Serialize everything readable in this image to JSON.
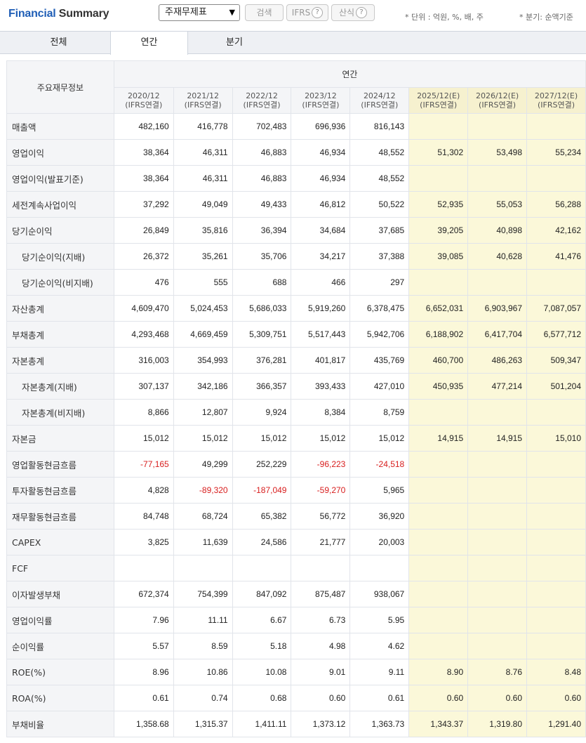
{
  "header": {
    "title_part1": "Financial",
    "title_part2": " Summary",
    "select_value": "주재무제표",
    "search_label": "검색",
    "ifrs_label": "IFRS",
    "formula_label": "산식",
    "help_glyph": "?",
    "unit_note": "* 단위 : 억원, %, 배, 주",
    "period_note": "* 분기: 순액기준"
  },
  "tabs": [
    "전체",
    "연간",
    "분기"
  ],
  "table": {
    "row_header_label": "주요재무정보",
    "group_label": "연간",
    "periods": [
      {
        "year": "2020/12",
        "basis": "(IFRS연결)"
      },
      {
        "year": "2021/12",
        "basis": "(IFRS연결)"
      },
      {
        "year": "2022/12",
        "basis": "(IFRS연결)"
      },
      {
        "year": "2023/12",
        "basis": "(IFRS연결)"
      },
      {
        "year": "2024/12",
        "basis": "(IFRS연결)"
      },
      {
        "year": "2025/12(E)",
        "basis": "(IFRS연결)"
      },
      {
        "year": "2026/12(E)",
        "basis": "(IFRS연결)"
      },
      {
        "year": "2027/12(E)",
        "basis": "(IFRS연결)"
      }
    ],
    "rows": [
      {
        "label": "매출액",
        "indent": false,
        "values": [
          "482,160",
          "416,778",
          "702,483",
          "696,936",
          "816,143",
          "",
          "",
          ""
        ]
      },
      {
        "label": "영업이익",
        "indent": false,
        "values": [
          "38,364",
          "46,311",
          "46,883",
          "46,934",
          "48,552",
          "51,302",
          "53,498",
          "55,234"
        ]
      },
      {
        "label": "영업이익(발표기준)",
        "indent": false,
        "values": [
          "38,364",
          "46,311",
          "46,883",
          "46,934",
          "48,552",
          "",
          "",
          ""
        ]
      },
      {
        "label": "세전계속사업이익",
        "indent": false,
        "values": [
          "37,292",
          "49,049",
          "49,433",
          "46,812",
          "50,522",
          "52,935",
          "55,053",
          "56,288"
        ]
      },
      {
        "label": "당기순이익",
        "indent": false,
        "values": [
          "26,849",
          "35,816",
          "36,394",
          "34,684",
          "37,685",
          "39,205",
          "40,898",
          "42,162"
        ]
      },
      {
        "label": "당기순이익(지배)",
        "indent": true,
        "values": [
          "26,372",
          "35,261",
          "35,706",
          "34,217",
          "37,388",
          "39,085",
          "40,628",
          "41,476"
        ]
      },
      {
        "label": "당기순이익(비지배)",
        "indent": true,
        "values": [
          "476",
          "555",
          "688",
          "466",
          "297",
          "",
          "",
          ""
        ]
      },
      {
        "label": "자산총계",
        "indent": false,
        "values": [
          "4,609,470",
          "5,024,453",
          "5,686,033",
          "5,919,260",
          "6,378,475",
          "6,652,031",
          "6,903,967",
          "7,087,057"
        ]
      },
      {
        "label": "부채총계",
        "indent": false,
        "values": [
          "4,293,468",
          "4,669,459",
          "5,309,751",
          "5,517,443",
          "5,942,706",
          "6,188,902",
          "6,417,704",
          "6,577,712"
        ]
      },
      {
        "label": "자본총계",
        "indent": false,
        "values": [
          "316,003",
          "354,993",
          "376,281",
          "401,817",
          "435,769",
          "460,700",
          "486,263",
          "509,347"
        ]
      },
      {
        "label": "자본총계(지배)",
        "indent": true,
        "values": [
          "307,137",
          "342,186",
          "366,357",
          "393,433",
          "427,010",
          "450,935",
          "477,214",
          "501,204"
        ]
      },
      {
        "label": "자본총계(비지배)",
        "indent": true,
        "values": [
          "8,866",
          "12,807",
          "9,924",
          "8,384",
          "8,759",
          "",
          "",
          ""
        ]
      },
      {
        "label": "자본금",
        "indent": false,
        "values": [
          "15,012",
          "15,012",
          "15,012",
          "15,012",
          "15,012",
          "14,915",
          "14,915",
          "15,010"
        ]
      },
      {
        "label": "영업활동현금흐름",
        "indent": false,
        "values": [
          "-77,165",
          "49,299",
          "252,229",
          "-96,223",
          "-24,518",
          "",
          "",
          ""
        ]
      },
      {
        "label": "투자활동현금흐름",
        "indent": false,
        "values": [
          "4,828",
          "-89,320",
          "-187,049",
          "-59,270",
          "5,965",
          "",
          "",
          ""
        ]
      },
      {
        "label": "재무활동현금흐름",
        "indent": false,
        "values": [
          "84,748",
          "68,724",
          "65,382",
          "56,772",
          "36,920",
          "",
          "",
          ""
        ]
      },
      {
        "label": "CAPEX",
        "indent": false,
        "values": [
          "3,825",
          "11,639",
          "24,586",
          "21,777",
          "20,003",
          "",
          "",
          ""
        ]
      },
      {
        "label": "FCF",
        "indent": false,
        "values": [
          "",
          "",
          "",
          "",
          "",
          "",
          "",
          ""
        ]
      },
      {
        "label": "이자발생부채",
        "indent": false,
        "values": [
          "672,374",
          "754,399",
          "847,092",
          "875,487",
          "938,067",
          "",
          "",
          ""
        ]
      },
      {
        "label": "영업이익률",
        "indent": false,
        "values": [
          "7.96",
          "11.11",
          "6.67",
          "6.73",
          "5.95",
          "",
          "",
          ""
        ]
      },
      {
        "label": "순이익률",
        "indent": false,
        "values": [
          "5.57",
          "8.59",
          "5.18",
          "4.98",
          "4.62",
          "",
          "",
          ""
        ]
      },
      {
        "label": "ROE(%)",
        "indent": false,
        "values": [
          "8.96",
          "10.86",
          "10.08",
          "9.01",
          "9.11",
          "8.90",
          "8.76",
          "8.48"
        ]
      },
      {
        "label": "ROA(%)",
        "indent": false,
        "values": [
          "0.61",
          "0.74",
          "0.68",
          "0.60",
          "0.61",
          "0.60",
          "0.60",
          "0.60"
        ]
      },
      {
        "label": "부채비율",
        "indent": false,
        "values": [
          "1,358.68",
          "1,315.37",
          "1,411.11",
          "1,373.12",
          "1,363.73",
          "1,343.37",
          "1,319.80",
          "1,291.40"
        ]
      }
    ]
  },
  "colors": {
    "title_blue": "#1f5eb6",
    "estimate_bg": "#fbf8d9",
    "negative": "#d81e1e",
    "header_bg": "#f4f5f7"
  }
}
